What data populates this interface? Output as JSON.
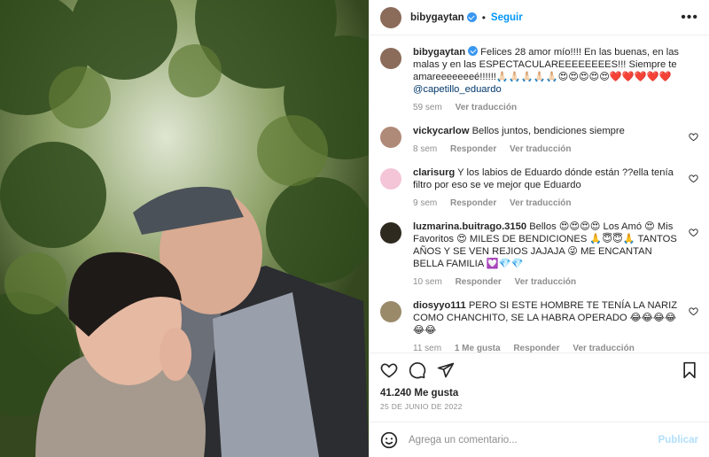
{
  "header": {
    "username": "bibygaytan",
    "separator": "•",
    "follow_label": "Seguir",
    "more_label": "•••"
  },
  "caption": {
    "username": "bibygaytan",
    "text": "Felices 28 amor mío!!!! En las buenas, en las malas y en las ESPECTACULAREEEEEEEES!!! Siempre te amareeeeeeeé!!!!!!🙏🏻🙏🏻🙏🏻🙏🏻🙏🏻😍😍😍😍😍❤️❤️❤️❤️❤️",
    "mention": "@capetillo_eduardo",
    "time": "59 sem",
    "translate": "Ver traducción"
  },
  "comments": [
    {
      "username": "vickycarlow",
      "text": "Bellos juntos, bendiciones siempre",
      "time": "8 sem",
      "reply": "Responder",
      "translate": "Ver traducción"
    },
    {
      "username": "clarisurg",
      "text": "Y los labios de Eduardo dónde están ??ella tenía filtro por eso se ve mejor que Eduardo",
      "time": "9 sem",
      "reply": "Responder",
      "translate": "Ver traducción"
    },
    {
      "username": "luzmarina.buitrago.3150",
      "text": "Bellos 😍😍😍😍 Los Amó 😍 Mis Favoritos 😍 MILES DE BENDICIONES 🙏😇😇🙏 TANTOS AÑOS Y SE VEN REJIOS JAJAJA 😜 ME ENCANTAN BELLA FAMILIA 💟💎💎",
      "time": "10 sem",
      "reply": "Responder",
      "translate": "Ver traducción"
    },
    {
      "username": "diosyyo111",
      "text": "PERO SI ESTE HOMBRE TE TENÍA LA NARIZ COMO CHANCHITO, SE LA HABRA OPERADO 😂😂😂😂😂😂",
      "time": "11 sem",
      "likes": "1 Me gusta",
      "reply": "Responder",
      "translate": "Ver traducción"
    }
  ],
  "actions": {
    "icons": [
      "heart-icon",
      "comment-icon",
      "share-icon",
      "bookmark-icon"
    ]
  },
  "likes": "41.240 Me gusta",
  "date": "25 DE JUNIO DE 2022",
  "add_comment": {
    "placeholder": "Agrega un comentario...",
    "publish_label": "Publicar"
  },
  "colors": {
    "accent": "#0095f6",
    "verified": "#3897f0",
    "muted": "#8e8e8e",
    "publish_disabled": "#b2dffc"
  }
}
